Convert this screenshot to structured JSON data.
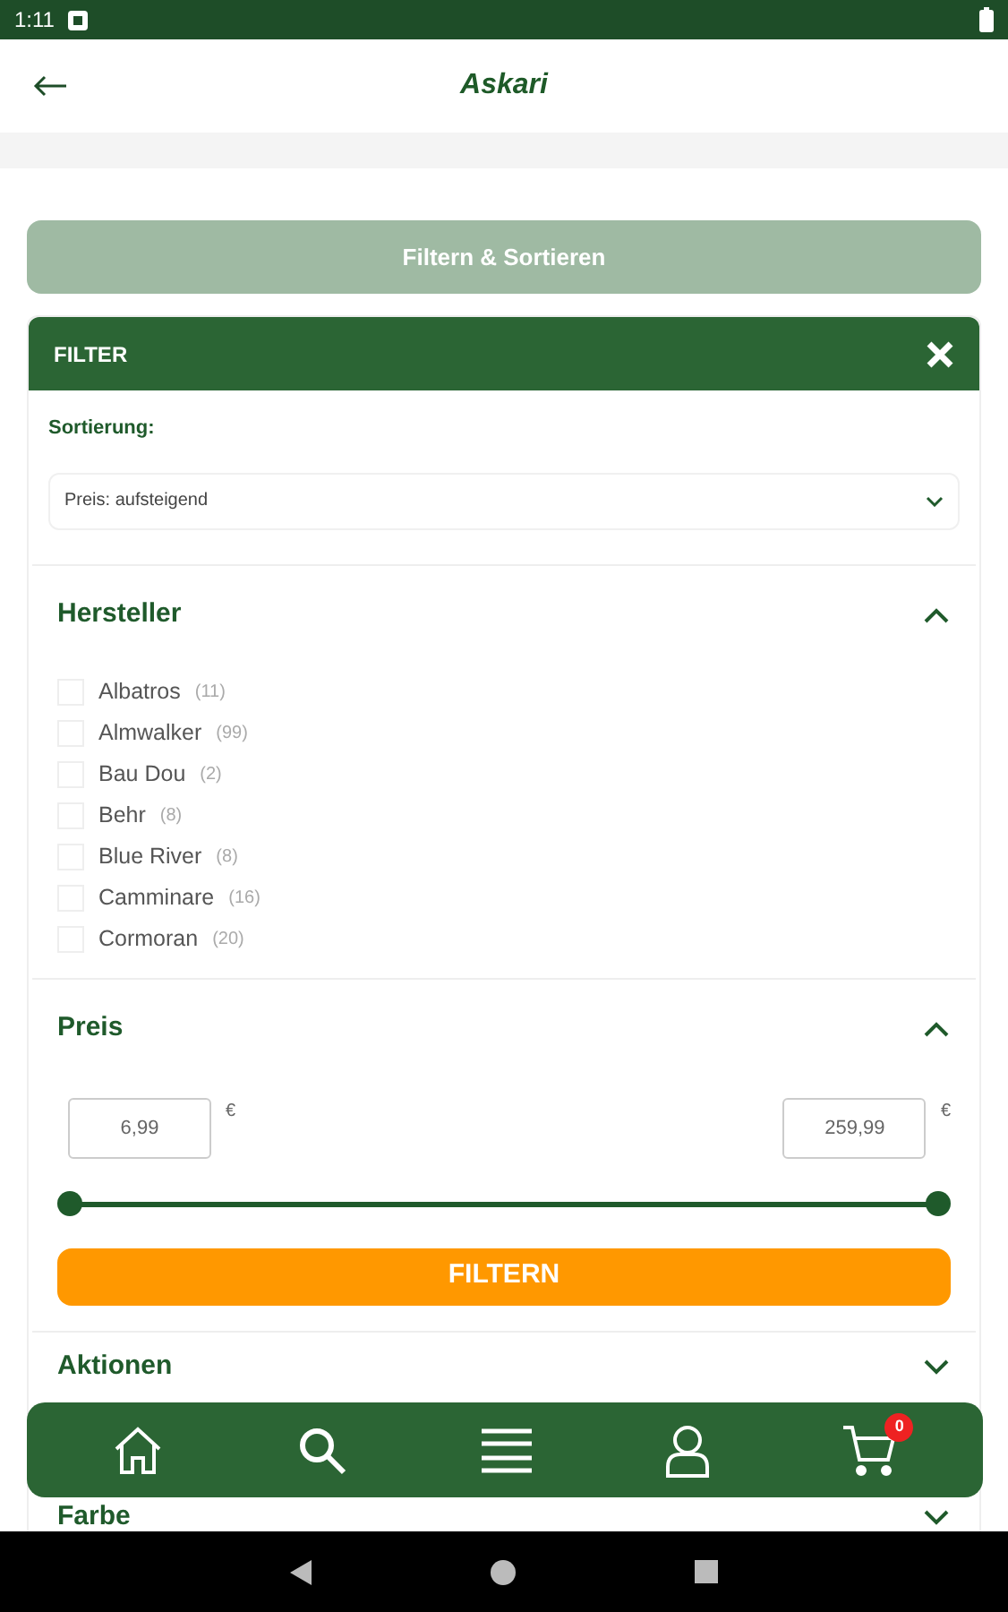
{
  "status_bar": {
    "time": "1:11"
  },
  "header": {
    "logo": "Askari"
  },
  "filter_sort_button": {
    "label": "Filtern & Sortieren",
    "disabled": true
  },
  "filter_panel": {
    "title": "FILTER",
    "sort": {
      "label": "Sortierung:",
      "value": "Preis: aufsteigend"
    },
    "sections": [
      {
        "kind": "checklist",
        "title": "Hersteller",
        "expanded": true,
        "items": [
          {
            "label": "Albatros",
            "count": "(11)",
            "checked": false
          },
          {
            "label": "Almwalker",
            "count": "(99)",
            "checked": false
          },
          {
            "label": "Bau Dou",
            "count": "(2)",
            "checked": false
          },
          {
            "label": "Behr",
            "count": "(8)",
            "checked": false
          },
          {
            "label": "Blue River",
            "count": "(8)",
            "checked": false
          },
          {
            "label": "Camminare",
            "count": "(16)",
            "checked": false
          },
          {
            "label": "Cormoran",
            "count": "(20)",
            "checked": false
          }
        ]
      },
      {
        "kind": "price",
        "title": "Preis",
        "expanded": true,
        "min": "6,99",
        "max": "259,99",
        "currency": "€",
        "thumbs": [
          {
            "level": 0
          },
          {
            "level": 1
          }
        ],
        "button": "FILTERN"
      },
      {
        "kind": "collapsed",
        "title": "Aktionen",
        "expanded": false
      },
      {
        "kind": "collapsed",
        "title": "Farbe",
        "expanded": false
      }
    ]
  },
  "bottom_nav": {
    "cart_badge": "0"
  }
}
